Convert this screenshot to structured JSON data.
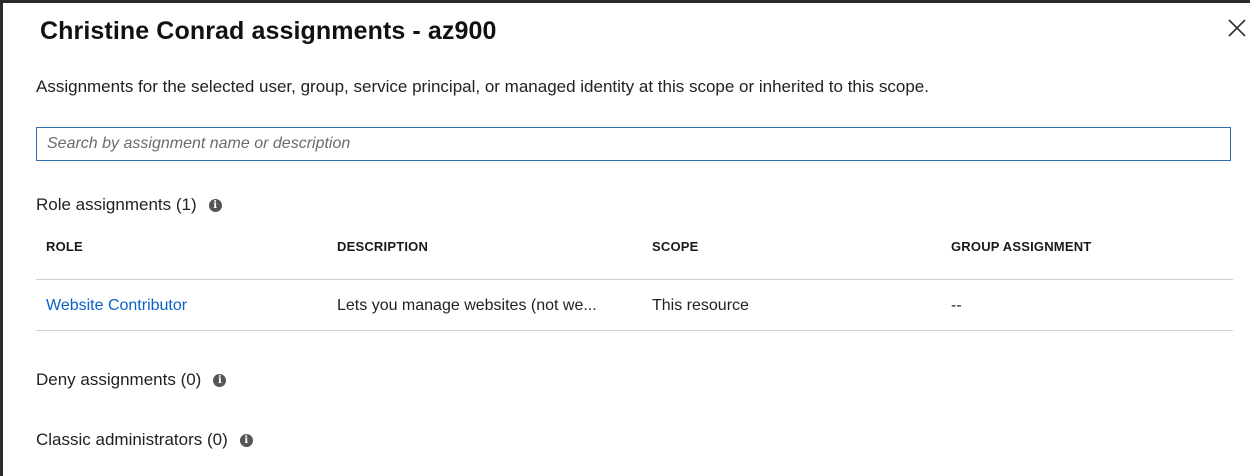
{
  "title": "Christine Conrad assignments - az900",
  "subtitle": "Assignments for the selected user, group, service principal, or managed identity at this scope or inherited to this scope.",
  "search": {
    "placeholder": "Search by assignment name or description",
    "value": ""
  },
  "role_assignments": {
    "label": "Role assignments (1)",
    "columns": [
      "ROLE",
      "DESCRIPTION",
      "SCOPE",
      "GROUP ASSIGNMENT"
    ],
    "rows": [
      {
        "role": "Website Contributor",
        "description": "Lets you manage websites (not we...",
        "scope": "This resource",
        "group_assignment": "--"
      }
    ]
  },
  "deny_assignments": {
    "label": "Deny assignments (0)"
  },
  "classic_administrators": {
    "label": "Classic administrators (0)"
  },
  "icons": {
    "close": "close-icon",
    "info": "info-icon"
  },
  "colors": {
    "link": "#0b62c9",
    "search_border": "#2f6fad"
  }
}
